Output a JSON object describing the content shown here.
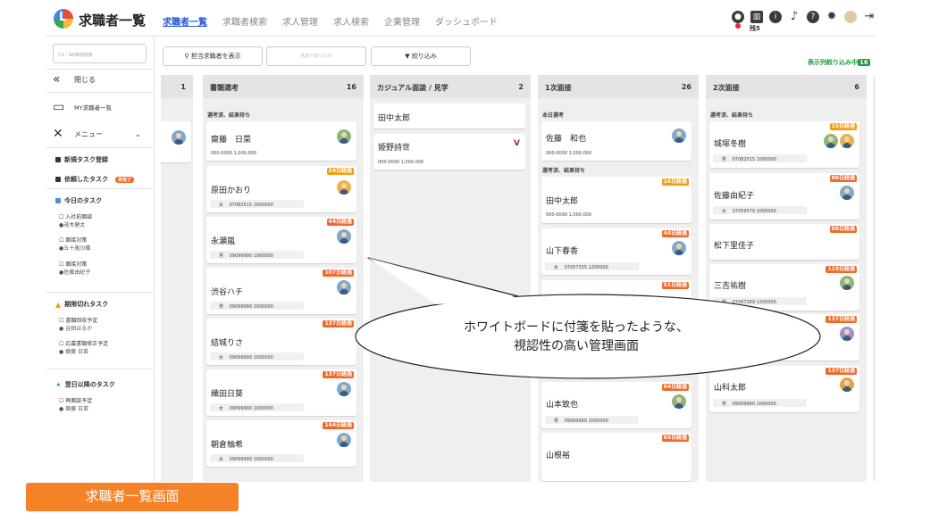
{
  "header": {
    "title": "求職者一覧",
    "nav": [
      "求職者一覧",
      "求職者検索",
      "求人管理",
      "求人検索",
      "企業管理",
      "ダッシュボード"
    ],
    "icon_badge": "残5"
  },
  "sidebar": {
    "search_placeholder": "CA・RA両組検索",
    "close_label": "閉じる",
    "my_list_label": "MY求職者一覧",
    "menu_label": "メニュー",
    "new_task": "新規タスク登録",
    "requested_task": "依頼したタスク",
    "requested_badge": "未完了",
    "today_task": "今日のタスク",
    "today_items": [
      {
        "title": "入社前面談",
        "who": "●茂木健太"
      },
      {
        "title": "面接対策",
        "who": "●五十嵐沙織"
      },
      {
        "title": "面接対策",
        "who": "●佐藤由紀子"
      }
    ],
    "overdue_task": "期限切れタスク",
    "overdue_items": [
      {
        "title": "書類回収予定",
        "who": "● 吉田はるか"
      },
      {
        "title": "応募書類修正予定",
        "who": "● 齋藤 日菜"
      }
    ],
    "later_task": "翌日以降のタスク",
    "later_items": [
      {
        "title": "再面談予定",
        "who": "● 齋藤 日菜"
      }
    ]
  },
  "toolbar": {
    "show_owner": "担当求職者を表示",
    "search_name": "名前で絞り込み",
    "filter": "絞り込み",
    "filter_note": "表示列絞り込み中",
    "filter_count": "16"
  },
  "board": {
    "col0": {
      "count": "1"
    },
    "col1": {
      "name": "書類選考",
      "count": "16",
      "sub": "選考済、結果待ち",
      "cards": [
        {
          "name": "齋藤　日菜",
          "line": "000-0000  1,000,000"
        },
        {
          "badge": "24日経過",
          "name": "原田かおり",
          "tag": "女　 07082515  1000000"
        },
        {
          "badge": "44日経過",
          "name": "永瀬嵐",
          "tag": "男　 09099990  1000000"
        },
        {
          "badge": "107日経過",
          "name": "渋谷ハチ",
          "tag": "男　 09099990  1000000"
        },
        {
          "badge": "137日経過",
          "name": "結城りさ",
          "tag": "女　 09099990  1000000"
        },
        {
          "badge": "137日経過",
          "name": "織田日葵",
          "tag": "女　 09099990  1000000"
        },
        {
          "badge": "144日経過",
          "name": "朝倉柚希",
          "tag": "女　 09099990  1000000"
        }
      ]
    },
    "col2": {
      "name": "カジュアル面談 / 見学",
      "count": "2",
      "cards": [
        {
          "name": "田中太郎"
        },
        {
          "name": "姫野詩世",
          "line": "000-0000  1,000,000"
        }
      ]
    },
    "col3": {
      "name": "1次面接",
      "count": "26",
      "sub1": "本日選考",
      "sub2": "選考済、結果待ち",
      "cards": [
        {
          "name": "佐藤　和也",
          "line": "000-0000  1,000,000"
        },
        {
          "badge": "16日経過",
          "name": "田中太郎",
          "line": "000-0000  1,000,000"
        },
        {
          "badge": "44日経過",
          "name": "山下春香",
          "tag": "女　 07057335  1200000"
        },
        {
          "badge": "51日経過"
        },
        {
          "badge": "64日経過",
          "name": "山本致也",
          "tag": "男　 09099990  1000000"
        },
        {
          "badge": "65日経過",
          "name": "山根裕"
        }
      ]
    },
    "col4": {
      "name": "2次面接",
      "count": "6",
      "sub": "選考済、結果待ち",
      "cards": [
        {
          "badge": "15日経過",
          "name": "城塚冬樹",
          "tag": "男　 07082515  1000000"
        },
        {
          "badge": "86日経過",
          "name": "佐藤由紀子",
          "tag": "女　 07059579  1000000"
        },
        {
          "badge": "86日経過",
          "name": "松下里佳子"
        },
        {
          "badge": "119日経過",
          "name": "三吉祐樹",
          "tag": "男　 07067269  1200000"
        },
        {
          "badge": "137日経過"
        },
        {
          "badge": "137日経過",
          "name": "山科太郎",
          "tag": "男　 09099990  1000000"
        }
      ]
    }
  },
  "callout": {
    "line1": "ホワイトボードに付箋を貼ったような、",
    "line2": "視認性の高い管理画面"
  },
  "caption": "求職者一覧画面"
}
